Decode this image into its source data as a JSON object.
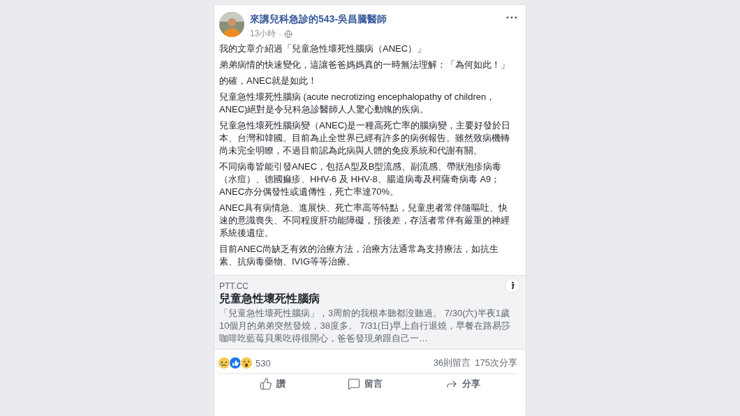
{
  "post": {
    "author": "來講兒科急診的543-吳昌騰醫師",
    "time": "13小時",
    "separator": "·",
    "paragraphs": [
      "我的文章介紹過「兒童急性壞死性腦病（ANEC）」",
      "弟弟病情的快速變化，這讓爸爸媽媽真的一時無法理解：「為何如此！」",
      "的確，ANEC就是如此！",
      "兒童急性壞死性腦病 (acute necrotizing encephalopathy of children，ANEC)絕對是令兒科急診醫師人人驚心動魄的疾病。",
      "兒童急性壞死性腦病變（ANEC)是一種高死亡率的腦病變，主要好發於日本、台灣和韓國。目前為止全世界已經有許多的病例報告。雖然致病機轉尚未完全明瞭，不過目前認為此病與人體的免疫系統和代謝有關。",
      "不同病毒皆能引發ANEC，包括A型及B型流感、副流感、帶狀泡疹病毒（水痘）、德國痲疹、HHV-6 及 HHV-8、腸道病毒及柯薩奇病毒 A9；ANEC亦分偶發性或遺傳性，死亡率達70%。",
      "ANEC具有病情急、進展快、死亡率高等特點，兒童患者常伴隨嘔吐、快速的意識喪失、不同程度肝功能障礙，預後差，存活者常伴有嚴重的神經系統後遺症。",
      "目前ANEC尚缺乏有效的治療方法，治療方法通常為支持療法，如抗生素、抗病毒藥物、IVIG等等治療。"
    ],
    "link": {
      "domain": "PTT.CC",
      "title": "兒童急性壞死性腦病",
      "description": "「兒童急性壞死性腦病」，3周前的我根本聽都沒聽過。 7/30(六)半夜1歲10個月的弟弟突然發燒，38度多。 7/31(日)早上自行退燒，早餐在路易莎咖啡吃藍莓貝果吃得很開心，爸爸發現弟跟自己一…"
    },
    "reactions": {
      "faces": [
        {
          "kind": "sad"
        },
        {
          "kind": "like"
        },
        {
          "kind": "wow"
        }
      ],
      "count": "530"
    },
    "comments": "36則留言",
    "shares": "175次分享",
    "actions": [
      {
        "kind": "like",
        "label": "讚"
      },
      {
        "kind": "comment",
        "label": "留言"
      },
      {
        "kind": "share",
        "label": "分享"
      }
    ]
  }
}
